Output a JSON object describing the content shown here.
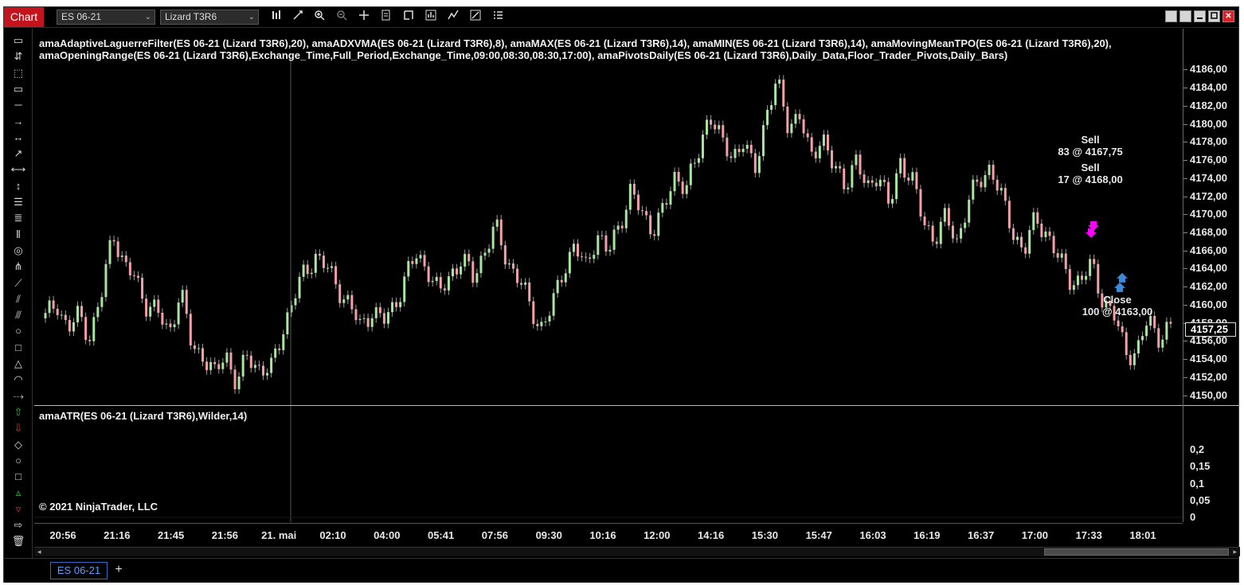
{
  "titlebar": {
    "window_label": "Chart",
    "instrument": "ES 06-21",
    "bar_type": "Lizard T3R6",
    "dropdown_glyph": "⌄",
    "close_glyph": "✕"
  },
  "colors": {
    "accent_red": "#c4131c",
    "bar_up": "#a8e6a0",
    "bar_down": "#f4a0a8",
    "sell_marker": "#ff00ff",
    "buy_marker": "#3a8bdc",
    "tab_blue": "#5aa0ff"
  },
  "top_toolbar_icons": [
    "bar-style-icon",
    "draw-tool-icon",
    "zoom-in-icon",
    "zoom-out-icon",
    "crosshair-icon",
    "data-box-icon",
    "chart-trader-icon",
    "strategies-icon",
    "indicators-icon",
    "properties-icon",
    "template-icon"
  ],
  "left_toolbar_icons": [
    "ruler-icon",
    "risk-reward-icon",
    "region-icon",
    "rectangle-region-icon",
    "line-icon",
    "ray-icon",
    "extended-line-icon",
    "arrow-line-icon",
    "horizontal-line-icon",
    "vertical-line-icon",
    "fibonacci-retracement-icon",
    "fibonacci-extension-icon",
    "fibonacci-time-icon",
    "fibonacci-circle-icon",
    "andrews-pitchfork-icon",
    "gann-fan-icon",
    "regression-channel-icon",
    "trend-channel-icon",
    "ellipse-icon",
    "rectangle-icon",
    "triangle-icon",
    "arc-icon",
    "path-icon",
    "arrow-up-icon",
    "arrow-down-icon",
    "diamond-icon",
    "dot-icon",
    "square-icon",
    "triangle-up-icon",
    "triangle-down-icon",
    "text-icon",
    "trash-icon"
  ],
  "indicators": {
    "price_panel_line1": "amaAdaptiveLaguerreFilter(ES 06-21 (Lizard T3R6),20), amaADXVMA(ES 06-21 (Lizard T3R6),8), amaMAX(ES 06-21 (Lizard T3R6),14), amaMIN(ES 06-21 (Lizard T3R6),14), amaMovingMeanTPO(ES 06-21 (Lizard T3R6),20),",
    "price_panel_line2": "amaOpeningRange(ES 06-21 (Lizard T3R6),Exchange_Time,Full_Period,Exchange_Time,09:00,08:30,08:30,17:00), amaPivotsDaily(ES 06-21 (Lizard T3R6),Daily_Data,Floor_Trader_Pivots,Daily_Bars)",
    "lower_panel": "amaATR(ES 06-21 (Lizard T3R6),Wilder,14)"
  },
  "copyright": "© 2021 NinjaTrader, LLC",
  "price_axis": {
    "labels": [
      "4186,00",
      "4184,00",
      "4182,00",
      "4180,00",
      "4178,00",
      "4176,00",
      "4174,00",
      "4172,00",
      "4170,00",
      "4168,00",
      "4166,00",
      "4164,00",
      "4162,00",
      "4160,00",
      "4158,00",
      "4156,00",
      "4154,00",
      "4152,00",
      "4150,00"
    ],
    "current_price": "4157,25"
  },
  "atr_axis": {
    "labels": [
      "0,2",
      "0,15",
      "0,1",
      "0,05",
      "0"
    ]
  },
  "time_axis": {
    "labels": [
      "20:56",
      "21:16",
      "21:45",
      "21:56",
      "21. mai",
      "02:10",
      "04:00",
      "05:41",
      "07:56",
      "09:30",
      "10:16",
      "12:00",
      "14:16",
      "15:30",
      "15:47",
      "16:03",
      "16:19",
      "16:37",
      "17:00",
      "17:33",
      "18:01"
    ]
  },
  "annotations": {
    "sell1_title": "Sell",
    "sell1_detail": "83 @ 4167,75",
    "sell2_title": "Sell",
    "sell2_detail": "17 @ 4168,00",
    "close_title": "Close",
    "close_detail": "100 @ 4163,00"
  },
  "tabs": {
    "instrument_tab": "ES 06-21",
    "add_tab": "+"
  },
  "chart_data": {
    "type": "line",
    "series_kind": "renko-style price bars",
    "ylim": [
      4149,
      4187
    ],
    "ylabel": "",
    "xlabel": "",
    "x_ticks": [
      "20:56",
      "21:16",
      "21:45",
      "21:56",
      "21. mai",
      "02:10",
      "04:00",
      "05:41",
      "07:56",
      "09:30",
      "10:16",
      "12:00",
      "14:16",
      "15:30",
      "15:47",
      "16:03",
      "16:19",
      "16:37",
      "17:00",
      "17:33",
      "18:01"
    ],
    "x": [
      0,
      1,
      2,
      3,
      4,
      5,
      6,
      7,
      8,
      9,
      10,
      11,
      12,
      13,
      14,
      15,
      16,
      17,
      18,
      19,
      20,
      21,
      22,
      23,
      24,
      25,
      26,
      27,
      28,
      29,
      30,
      31,
      32,
      33,
      34,
      35,
      36,
      37,
      38,
      39,
      40,
      41,
      42,
      43,
      44,
      45,
      46,
      47,
      48,
      49,
      50,
      51,
      52,
      53,
      54,
      55,
      56,
      57,
      58,
      59,
      60,
      61,
      62,
      63,
      64,
      65,
      66,
      67,
      68,
      69,
      70,
      71,
      72,
      73,
      74,
      75,
      76,
      77,
      78,
      79,
      80,
      81,
      82,
      83,
      84,
      85,
      86,
      87,
      88,
      89,
      90,
      91,
      92,
      93,
      94,
      95,
      96,
      97,
      98,
      99,
      100
    ],
    "close": [
      4158.5,
      4160.5,
      4157,
      4159,
      4156.5,
      4161,
      4168.5,
      4164,
      4163,
      4160,
      4159,
      4157,
      4161.5,
      4155.5,
      4154.5,
      4152,
      4155,
      4151,
      4154.5,
      4153,
      4152.5,
      4157,
      4160.5,
      4163.5,
      4165.5,
      4164,
      4162,
      4160,
      4157.5,
      4159.5,
      4158,
      4160,
      4163,
      4165.5,
      4164,
      4161,
      4163.5,
      4165,
      4163,
      4166,
      4168.5,
      4165,
      4163,
      4160,
      4157.5,
      4159.5,
      4164,
      4166.5,
      4164,
      4168,
      4165.5,
      4169,
      4172.5,
      4170,
      4168.5,
      4170.5,
      4174.5,
      4173,
      4176.5,
      4181.5,
      4178,
      4176.5,
      4178,
      4174.5,
      4181,
      4184.5,
      4180,
      4181,
      4176,
      4179,
      4175,
      4173.5,
      4176,
      4172.5,
      4175,
      4170.5,
      4176,
      4174,
      4169,
      4167.5,
      4169.5,
      4167,
      4171.5,
      4173.5,
      4175.5,
      4171.5,
      4168,
      4166,
      4169.5,
      4168,
      4165,
      4163,
      4162.5,
      4164.5,
      4160.5,
      4158.5,
      4155,
      4154.5,
      4158.5,
      4156.5,
      4157.25
    ],
    "current_price": 4157.25,
    "atr_ylim": [
      0,
      0.25
    ],
    "atr_ticks": [
      0,
      0.05,
      0.1,
      0.15,
      0.2
    ],
    "trades": [
      {
        "side": "Sell",
        "qty": 83,
        "price": 4167.75
      },
      {
        "side": "Sell",
        "qty": 17,
        "price": 4168.0
      },
      {
        "side": "Close",
        "qty": 100,
        "price": 4163.0
      }
    ]
  }
}
